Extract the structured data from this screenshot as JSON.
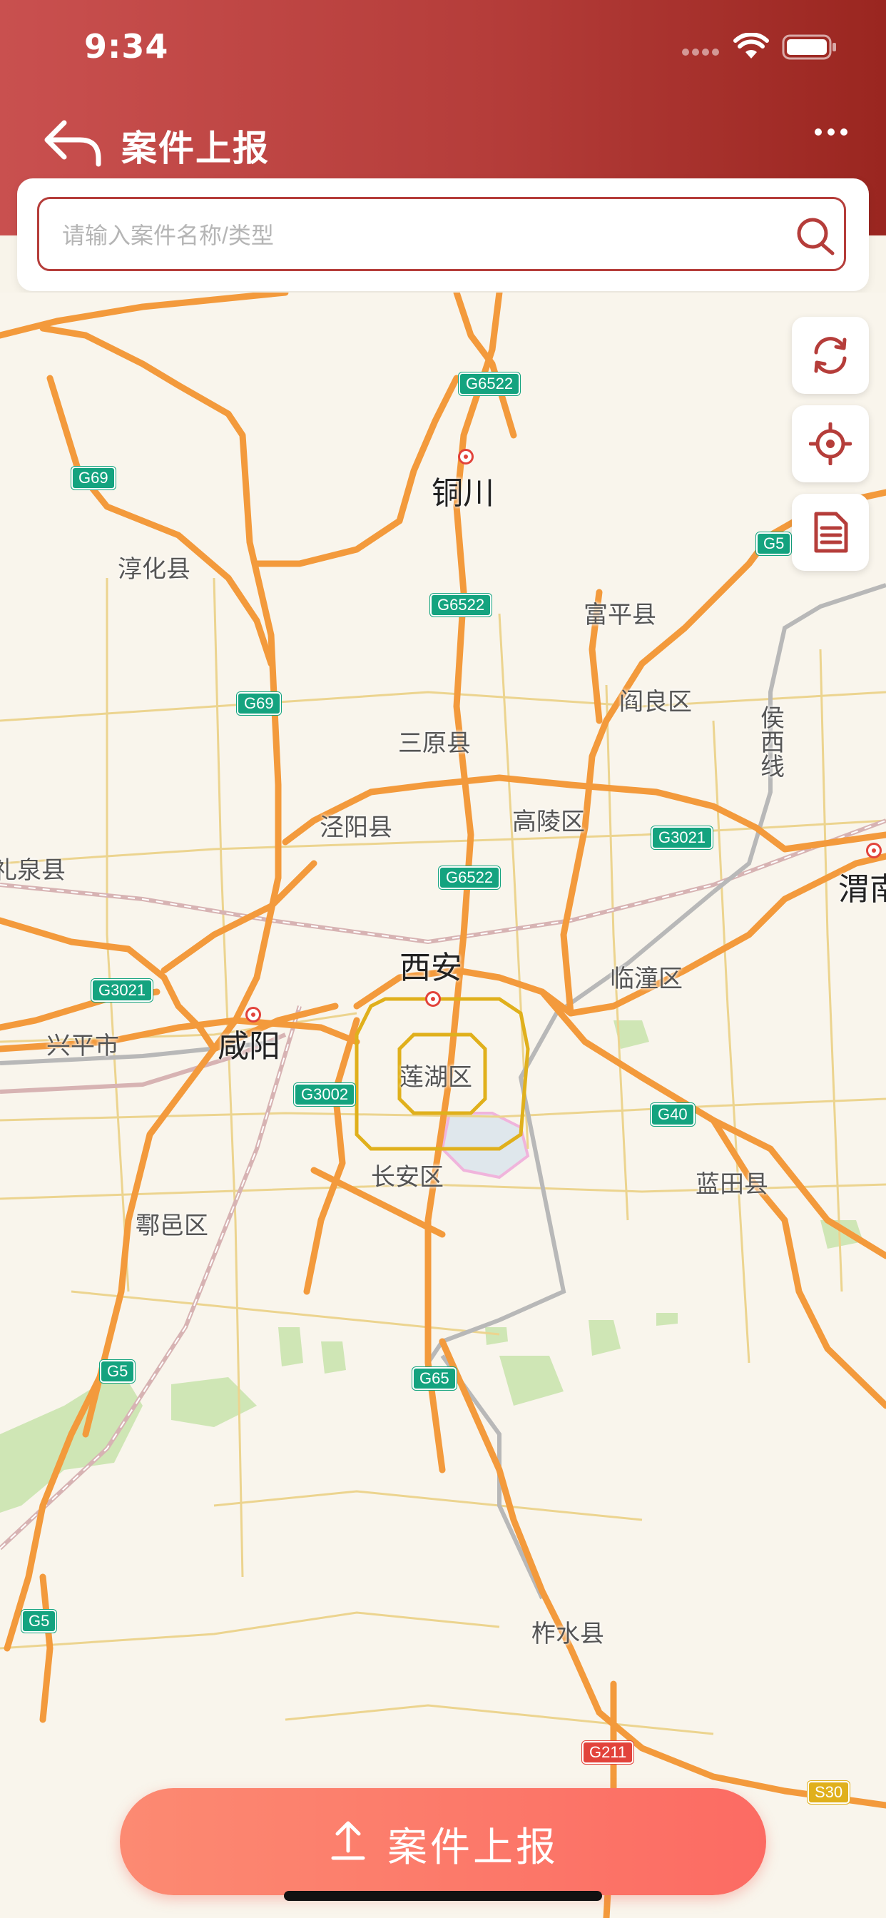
{
  "status_bar": {
    "time": "9:34"
  },
  "nav": {
    "title": "案件上报",
    "more_icon": "more-dots-icon",
    "back_icon": "back-arrow-icon"
  },
  "search": {
    "placeholder": "请输入案件名称/类型",
    "icon": "search-icon"
  },
  "side_tools": [
    {
      "name": "refresh",
      "icon": "refresh-icon"
    },
    {
      "name": "locate",
      "icon": "location-target-icon"
    },
    {
      "name": "document",
      "icon": "document-icon"
    }
  ],
  "map": {
    "cities": {
      "tongchuan": "铜川",
      "xian": "西安",
      "xianyang": "咸阳",
      "weinan": "渭南"
    },
    "districts": {
      "chunhua": "淳化县",
      "fuping": "富平县",
      "yanliang": "阎良区",
      "sanyuan": "三原县",
      "jingyang": "泾阳县",
      "gaoling": "高陵区",
      "liquan": "礼泉县",
      "lintong": "临潼区",
      "xingping": "兴平市",
      "lianhu": "莲湖区",
      "changan": "长安区",
      "lantian": "蓝田县",
      "huyi": "鄠邑区",
      "zhashui": "柞水县",
      "houxi": "侯西线"
    },
    "shields": {
      "g6522a": "G6522",
      "g6522b": "G6522",
      "g6522c": "G6522",
      "g69a": "G69",
      "g69b": "G69",
      "g5a": "G5",
      "g5b": "G5",
      "g5c": "G5",
      "g3021a": "G3021",
      "g3021b": "G3021",
      "g3002": "G3002",
      "g40": "G40",
      "g65": "G65",
      "g211": "G211",
      "s30": "S30"
    }
  },
  "report_button": {
    "label": "案件上报",
    "icon": "upload-icon"
  },
  "colors": {
    "header_start": "#c9504f",
    "header_end": "#9a2620",
    "accent": "#b53d3a",
    "button_start": "#fc8a72",
    "button_end": "#fc6b63",
    "road": "#f39a3c"
  }
}
